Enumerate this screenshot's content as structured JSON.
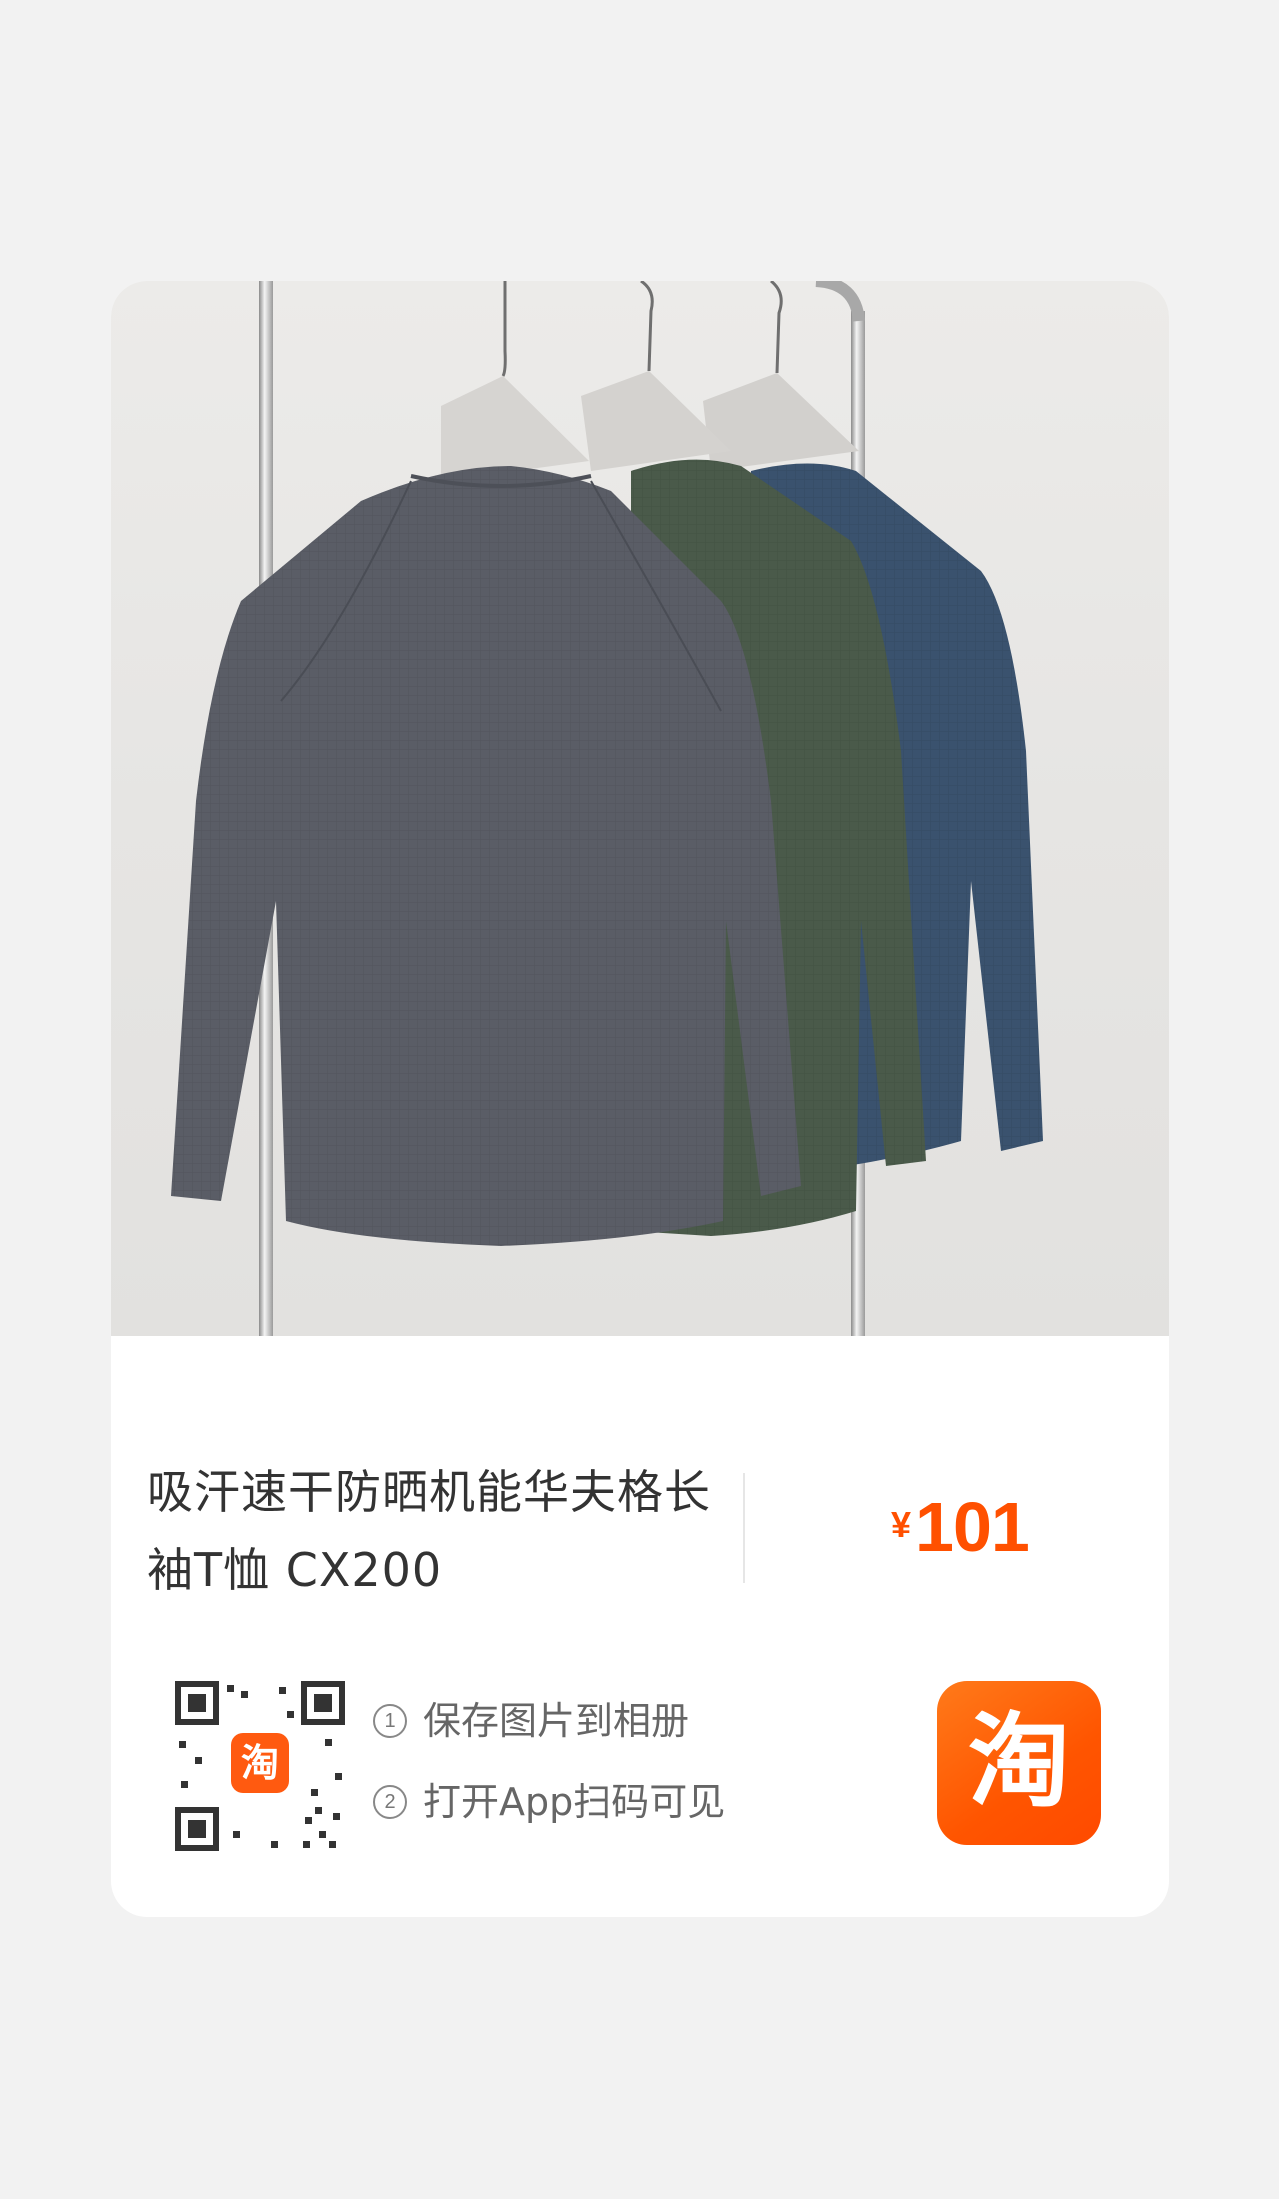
{
  "product": {
    "title_line1": "吸汗速干防晒机能华夫格长",
    "title_line2": "袖T恤 CX200",
    "price_symbol": "¥",
    "price_value": "101",
    "price_color": "#ff5000"
  },
  "share": {
    "step1_num": "1",
    "step1_text": "保存图片到相册",
    "step2_num": "2",
    "step2_text": "打开App扫码可见",
    "qr_badge_char": "淘",
    "app_logo_char": "淘",
    "logo_color": "#ff5500"
  },
  "photo": {
    "shirt_colors": [
      "#5a5d66",
      "#4a5a4a",
      "#3a526e"
    ]
  }
}
